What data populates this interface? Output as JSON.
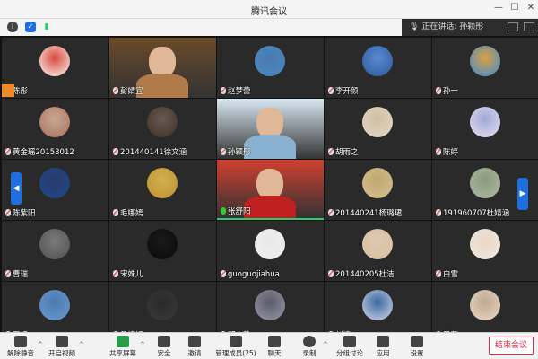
{
  "window": {
    "title": "腾讯会议"
  },
  "speaking": {
    "label": "正在讲话: 孙颖彤"
  },
  "participants": [
    {
      "name": "陈彤",
      "avatar": "#d94a3a",
      "bg": "#fafafa"
    },
    {
      "name": "彭婧宜",
      "avatar": "#b07a4a",
      "bg": "#6a4a2a",
      "video": true
    },
    {
      "name": "赵梦蕾",
      "avatar": "#4a7ab0",
      "bg": "#4a8ac0"
    },
    {
      "name": "李开颜",
      "avatar": "#5a8ad0",
      "bg": "#2a5a9a"
    },
    {
      "name": "孙一",
      "avatar": "#d9a040",
      "bg": "#3a8ad8"
    },
    {
      "name": "黄金瑶20153012",
      "avatar": "#c9a890",
      "bg": "#a87060"
    },
    {
      "name": "201440141徐文涵",
      "avatar": "#6a5a50",
      "bg": "#3a3028"
    },
    {
      "name": "孙颖彤",
      "avatar": "#8ab0d0",
      "bg": "#d8e8f0",
      "video": true
    },
    {
      "name": "胡雨之",
      "avatar": "#d0c0a0",
      "bg": "#e0d8c8"
    },
    {
      "name": "陈婷",
      "avatar": "#a0a8d8",
      "bg": "#e8e0f0"
    },
    {
      "name": "陈紫阳",
      "avatar": "#2a3a6a",
      "bg": "#1a4a8a"
    },
    {
      "name": "毛娜嫣",
      "avatar": "#d0b050",
      "bg": "#c09030"
    },
    {
      "name": "张舒阳",
      "avatar": "#c02020",
      "bg": "#d04030",
      "video": true,
      "active": true
    },
    {
      "name": "201440241杨璐珺",
      "avatar": "#c0a870",
      "bg": "#d8c090"
    },
    {
      "name": "191960707杜婧涵",
      "avatar": "#8a9a7a",
      "bg": "#b0b8a8"
    },
    {
      "name": "曹瑞",
      "avatar": "#7a7a7a",
      "bg": "#505050"
    },
    {
      "name": "宋姝儿",
      "avatar": "#1a1a1a",
      "bg": "#0a0a0a"
    },
    {
      "name": "guoguojiahua",
      "avatar": "#e8e8e8",
      "bg": "#f0f0f0"
    },
    {
      "name": "201440205杜洁",
      "avatar": "#e0c8b0",
      "bg": "#d8c0a0"
    },
    {
      "name": "白雪",
      "avatar": "#e8d8c8",
      "bg": "#f0e8e0"
    },
    {
      "name": "王婷",
      "avatar": "#4a7ab0",
      "bg": "#6a9ad0"
    },
    {
      "name": "吕婕妤",
      "avatar": "#2a2a2a",
      "bg": "#3a3a3a"
    },
    {
      "name": "郭文静",
      "avatar": "#5a5a6a",
      "bg": "#9a9aa8"
    },
    {
      "name": "刘婕",
      "avatar": "#3a6aa0",
      "bg": "#d8d8e8"
    },
    {
      "name": "吴薇",
      "avatar": "#c0a890",
      "bg": "#e8d8c8"
    }
  ],
  "toolbar": {
    "mute": "解除静音",
    "video": "开启视频",
    "share": "共享屏幕",
    "security": "安全",
    "invite": "邀请",
    "members": "管理成员(25)",
    "chat": "聊天",
    "record": "录制",
    "breakout": "分组讨论",
    "apps": "应用",
    "settings": "设置",
    "end": "结束会议"
  },
  "colors": {
    "accent": "#1f6fe0",
    "end": "#e22244",
    "active_speaker": "#2ecc71"
  }
}
